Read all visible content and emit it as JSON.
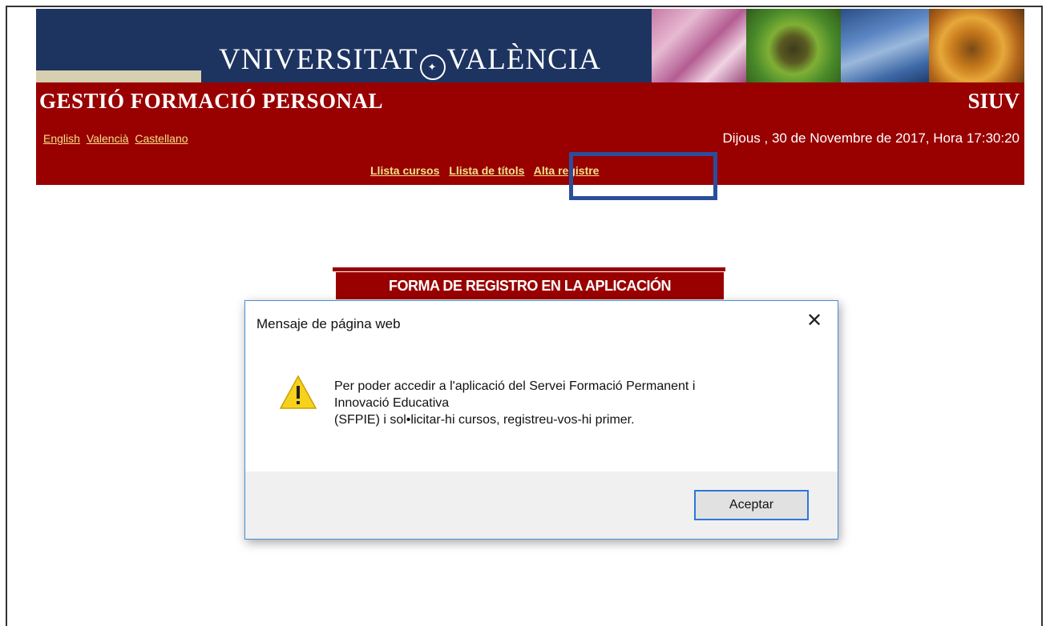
{
  "header": {
    "logo_text": "VNIVERSITAT DE VALÈNCIA",
    "logo_part1": "VNIVERSITAT",
    "logo_part2": "VALÈNCIA",
    "app_title": "GESTIÓ FORMACIÓ PERSONAL",
    "siuv": "SIUV",
    "languages": [
      "English",
      "Valencià",
      "Castellano"
    ],
    "datetime": "Dijous , 30 de Novembre de 2017, Hora 17:30:20",
    "menu": [
      "Llista cursos",
      "Llista de títols",
      "Alta registre"
    ]
  },
  "form": {
    "title": "FORMA DE REGISTRO EN LA APLICACIÓN"
  },
  "dialog": {
    "title": "Mensaje de página web",
    "message_lines": [
      "Per poder accedir a l'aplicació del Servei Formació Permanent i",
      "Innovació Educativa",
      "(SFPIE) i sol•licitar-hi cursos, registreu-vos-hi primer."
    ],
    "ok_label": "Aceptar",
    "close_symbol": "✕",
    "icon": "warning-icon"
  },
  "colors": {
    "header_blue": "#1d3461",
    "header_red": "#990000",
    "link_yellow": "#f2e28a",
    "highlight_blue": "#2b4e9c"
  }
}
